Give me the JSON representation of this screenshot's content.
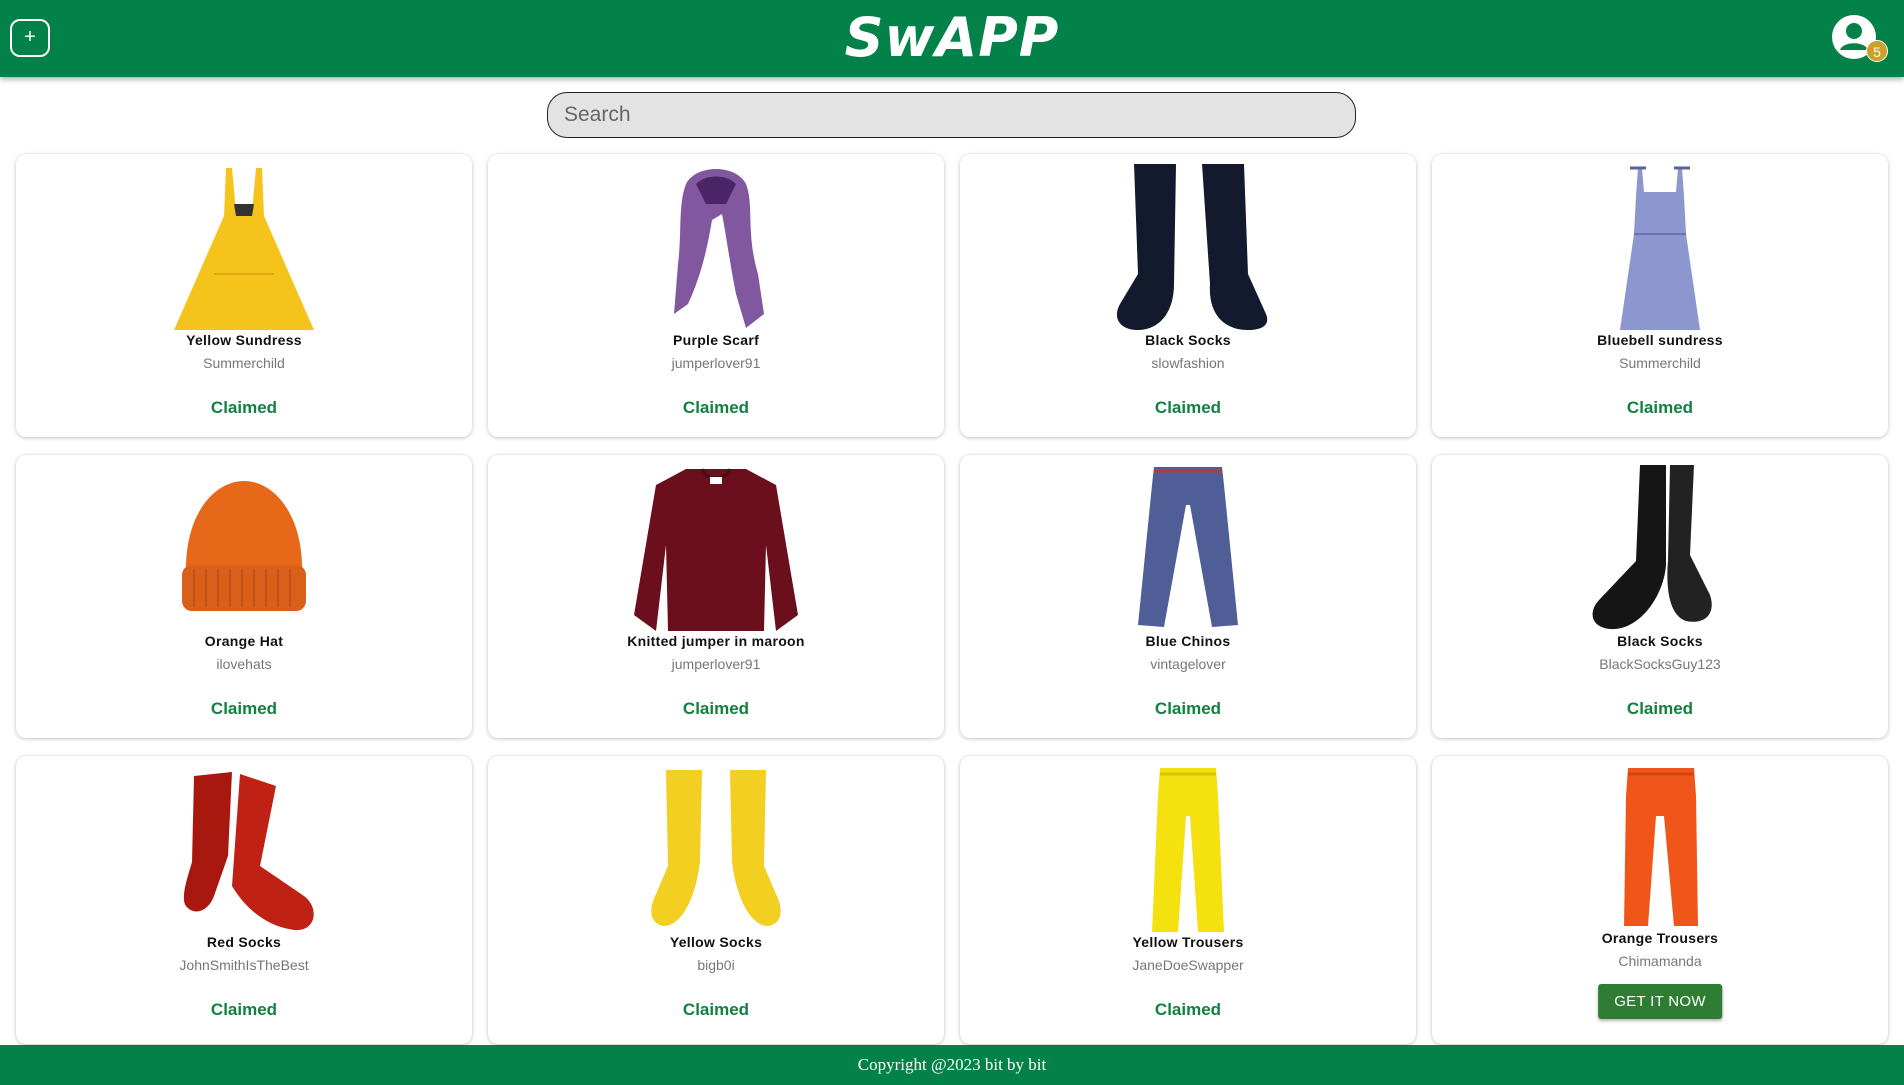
{
  "header": {
    "add_label": "+",
    "logo": "SwAPP",
    "notification_count": "5"
  },
  "search": {
    "placeholder": "Search"
  },
  "items": [
    {
      "title": "Yellow Sundress",
      "owner": "Summerchild",
      "status": "Claimed"
    },
    {
      "title": "Purple Scarf",
      "owner": "jumperlover91",
      "status": "Claimed"
    },
    {
      "title": "Black Socks",
      "owner": "slowfashion",
      "status": "Claimed"
    },
    {
      "title": "Bluebell sundress",
      "owner": "Summerchild",
      "status": "Claimed"
    },
    {
      "title": "Orange Hat",
      "owner": "ilovehats",
      "status": "Claimed"
    },
    {
      "title": "Knitted jumper in maroon",
      "owner": "jumperlover91",
      "status": "Claimed"
    },
    {
      "title": "Blue Chinos",
      "owner": "vintagelover",
      "status": "Claimed"
    },
    {
      "title": "Black Socks",
      "owner": "BlackSocksGuy123",
      "status": "Claimed"
    },
    {
      "title": "Red Socks",
      "owner": "JohnSmithIsTheBest",
      "status": "Claimed"
    },
    {
      "title": "Yellow Socks",
      "owner": "bigb0i",
      "status": "Claimed"
    },
    {
      "title": "Yellow Trousers",
      "owner": "JaneDoeSwapper",
      "status": "Claimed"
    },
    {
      "title": "Orange Trousers",
      "owner": "Chimamanda",
      "button": "GET IT NOW"
    }
  ],
  "footer": {
    "text": "Copyright @2023 bit by bit"
  },
  "colors": {
    "brand_green": "#028148",
    "claimed_green": "#12803f",
    "button_green": "#2e7d32"
  }
}
